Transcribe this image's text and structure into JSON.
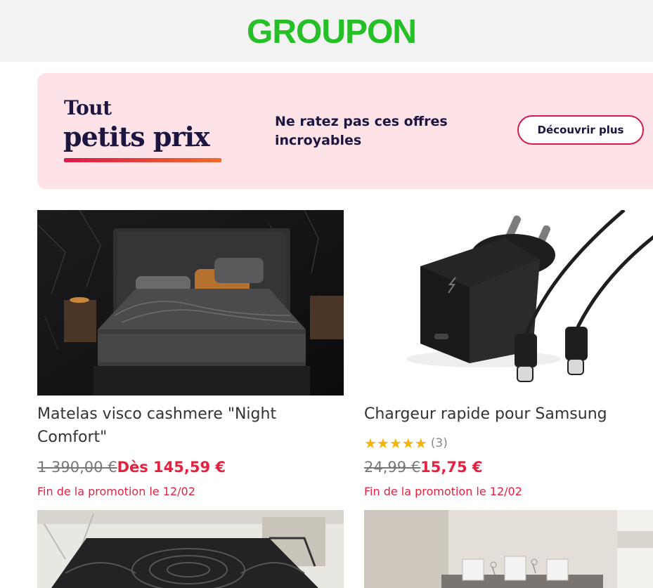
{
  "header": {
    "logo_text": "GROUPON",
    "brand_color": "#27bf27"
  },
  "banner": {
    "title_line1": "Tout",
    "title_line2": "petits prix",
    "message": "Ne ratez pas ces offres incroyables",
    "button_label": "Découvrir plus",
    "background": "#fde3e8",
    "accent": "#d81b4a"
  },
  "deals": [
    {
      "title": "Matelas visco cashmere \"Night Comfort\"",
      "old_price": "1 390,00 €",
      "new_price": "Dès 145,59 €",
      "promo": "Fin de la promotion le 12/02",
      "image_icon": "mattress-photo"
    },
    {
      "title": "Chargeur rapide pour Samsung",
      "stars": "★★★★★",
      "rating_count": "(3)",
      "old_price": "24,99 €",
      "new_price": "15,75 €",
      "promo": "Fin de la promotion le 12/02",
      "image_icon": "charger-photo"
    },
    {
      "image_icon": "mattress-photo"
    },
    {
      "image_icon": "dining-room-photo"
    }
  ]
}
